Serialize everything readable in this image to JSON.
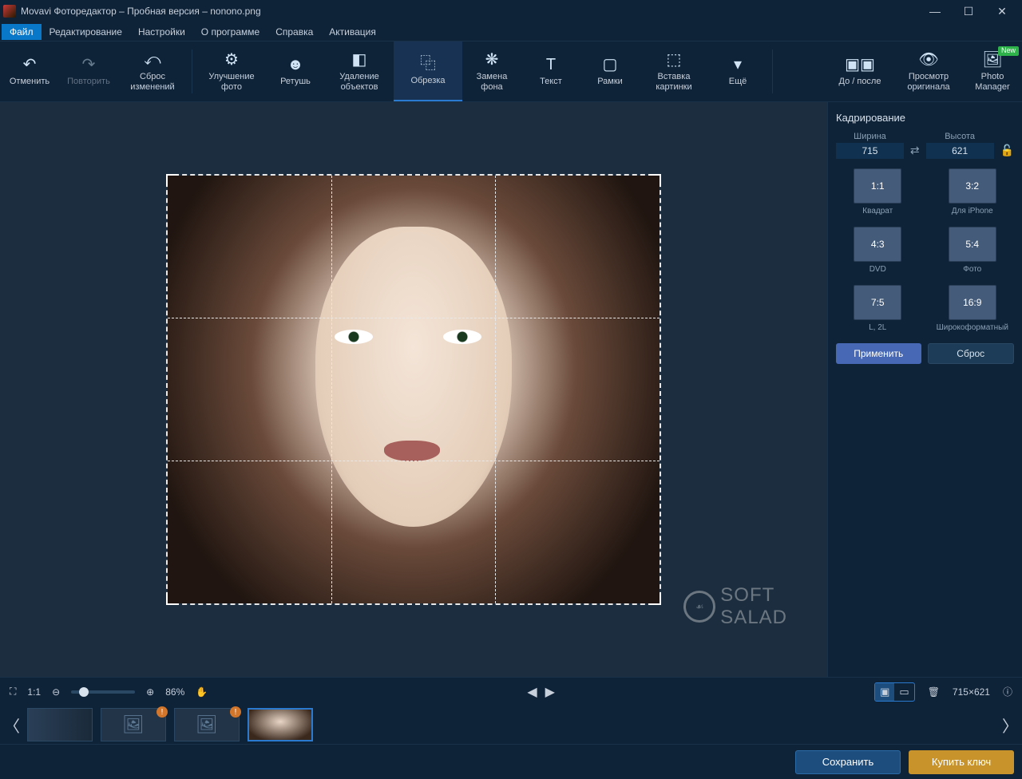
{
  "titlebar": {
    "title": "Movavi Фоторедактор – Пробная версия – nonono.png"
  },
  "menu": {
    "items": [
      "Файл",
      "Редактирование",
      "Настройки",
      "О программе",
      "Справка",
      "Активация"
    ],
    "active_index": 0
  },
  "toolbar": {
    "undo": "Отменить",
    "redo": "Повторить",
    "reset": "Сброс\nизменений",
    "enhance": "Улучшение\nфото",
    "retouch": "Ретушь",
    "remove": "Удаление\nобъектов",
    "crop": "Обрезка",
    "bgswap": "Замена\nфона",
    "text": "Текст",
    "frames": "Рамки",
    "insert": "Вставка\nкартинки",
    "more": "Ещё",
    "before_after": "До / после",
    "view_original": "Просмотр\nоригинала",
    "photo_manager": "Photo\nManager",
    "new_badge": "New"
  },
  "crop_panel": {
    "title": "Кадрирование",
    "width_label": "Ширина",
    "height_label": "Высота",
    "width_value": "715",
    "height_value": "621",
    "ratios": [
      {
        "ratio": "1:1",
        "label": "Квадрат"
      },
      {
        "ratio": "3:2",
        "label": "Для iPhone"
      },
      {
        "ratio": "4:3",
        "label": "DVD"
      },
      {
        "ratio": "5:4",
        "label": "Фото"
      },
      {
        "ratio": "7:5",
        "label": "L, 2L"
      },
      {
        "ratio": "16:9",
        "label": "Широкоформатный"
      }
    ],
    "apply": "Применить",
    "reset": "Сброс"
  },
  "statusbar": {
    "one_to_one": "1:1",
    "zoom": "86%",
    "dimensions": "715×621"
  },
  "bottombar": {
    "save": "Сохранить",
    "buy": "Купить ключ"
  },
  "watermark": {
    "text1": "SOFT",
    "text2": "SALAD"
  }
}
